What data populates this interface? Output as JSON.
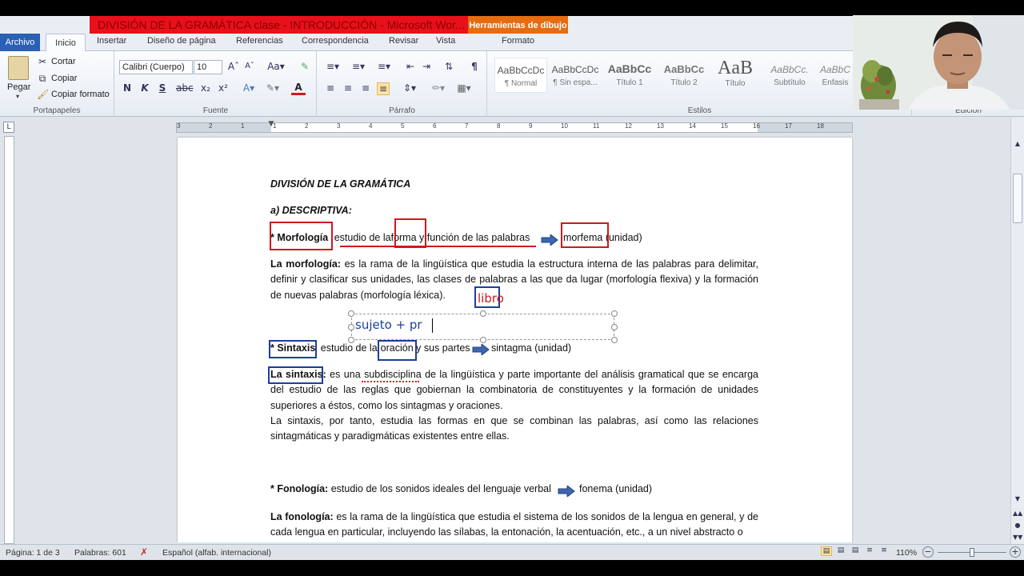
{
  "window": {
    "title": "DIVISIÓN DE LA GRAMÁTICA clase - INTRODUCCIÓN  -  Microsoft Wor...",
    "context_tab": "Herramientas de dibujo"
  },
  "tabs": {
    "archivo": "Archivo",
    "inicio": "Inicio",
    "insertar": "Insertar",
    "diseno": "Diseño de página",
    "referencias": "Referencias",
    "correspondencia": "Correspondencia",
    "revisar": "Revisar",
    "vista": "Vista",
    "formato": "Formato"
  },
  "ribbon": {
    "portapapeles": {
      "label": "Portapapeles",
      "pegar": "Pegar",
      "cortar": "Cortar",
      "copiar": "Copiar",
      "copiar_formato": "Copiar formato"
    },
    "fuente": {
      "label": "Fuente",
      "font": "Calibri (Cuerpo)",
      "size": "10",
      "bold": "N",
      "italic": "K",
      "underline": "S"
    },
    "parrafo": {
      "label": "Párrafo"
    },
    "estilos": {
      "label": "Estilos",
      "items": [
        {
          "preview": "AaBbCcDc",
          "name": "¶ Normal"
        },
        {
          "preview": "AaBbCcDc",
          "name": "¶ Sin espa..."
        },
        {
          "preview": "AaBbCc",
          "name": "Título 1"
        },
        {
          "preview": "AaBbCc",
          "name": "Título 2"
        },
        {
          "preview": "AaB",
          "name": "Título"
        },
        {
          "preview": "AaBbCc.",
          "name": "Subtítulo"
        },
        {
          "preview": "AaBbC",
          "name": "Énfasis"
        }
      ]
    },
    "edicion": {
      "label": "Edición"
    }
  },
  "ruler": {
    "numbers": [
      "3",
      "2",
      "1",
      "1",
      "2",
      "3",
      "4",
      "5",
      "6",
      "7",
      "8",
      "9",
      "10",
      "11",
      "12",
      "13",
      "14",
      "15",
      "16",
      "17",
      "18"
    ]
  },
  "document": {
    "heading": "DIVISIÓN DE LA GRAMÁTICA",
    "subheading": "a) DESCRIPTIVA:",
    "morf_line": {
      "star": "* Morfología",
      "p1": "estudio de la",
      "word": "forma",
      "p2": "y función de las palabras",
      "target": "morfema",
      "unit": "(unidad)"
    },
    "morf_para": {
      "lead": "La morfología:",
      "text": "es la rama de la lingüística que estudia la estructura interna de las palabras para delimitar, definir y clasificar sus unidades, las clases de palabras a las que da lugar (morfología flexiva) y la formación de nuevas palabras (morfología léxica)."
    },
    "annotation_red": "libro",
    "annotation_blue": "sujeto + pr",
    "sint_line": {
      "star": "* Sintaxis",
      "p1": "estudio de la",
      "word": "oración",
      "p2": "y sus partes",
      "target": "sintagma (unidad)"
    },
    "sint_para": {
      "lead": "La sintaxis:",
      "text": "es una subdisciplina de la lingüística y parte importante del análisis gramatical que se encarga del estudio de las reglas que gobiernan la combinatoria de constituyentes y la formación de unidades superiores a éstos, como los sintagmas y oraciones.",
      "text2": "La sintaxis, por tanto, estudia las formas en que se combinan las palabras, así como las relaciones sintagmáticas y paradigmáticas existentes entre ellas."
    },
    "fono_line": {
      "star": "* Fonología:",
      "p1": "estudio de los sonidos ideales del lenguaje verbal",
      "target": "fonema (unidad)"
    },
    "fono_para": {
      "lead": "La fonología:",
      "text": "es la rama de la lingüística que estudia el sistema de los sonidos de la lengua en general, y de cada lengua en particular, incluyendo las sílabas, la entonación, la acentuación, etc., a un nivel abstracto o"
    }
  },
  "status": {
    "pagina": "Página: 1 de 3",
    "palabras": "Palabras: 601",
    "idioma": "Español (alfab. internacional)",
    "zoom": "110%"
  }
}
